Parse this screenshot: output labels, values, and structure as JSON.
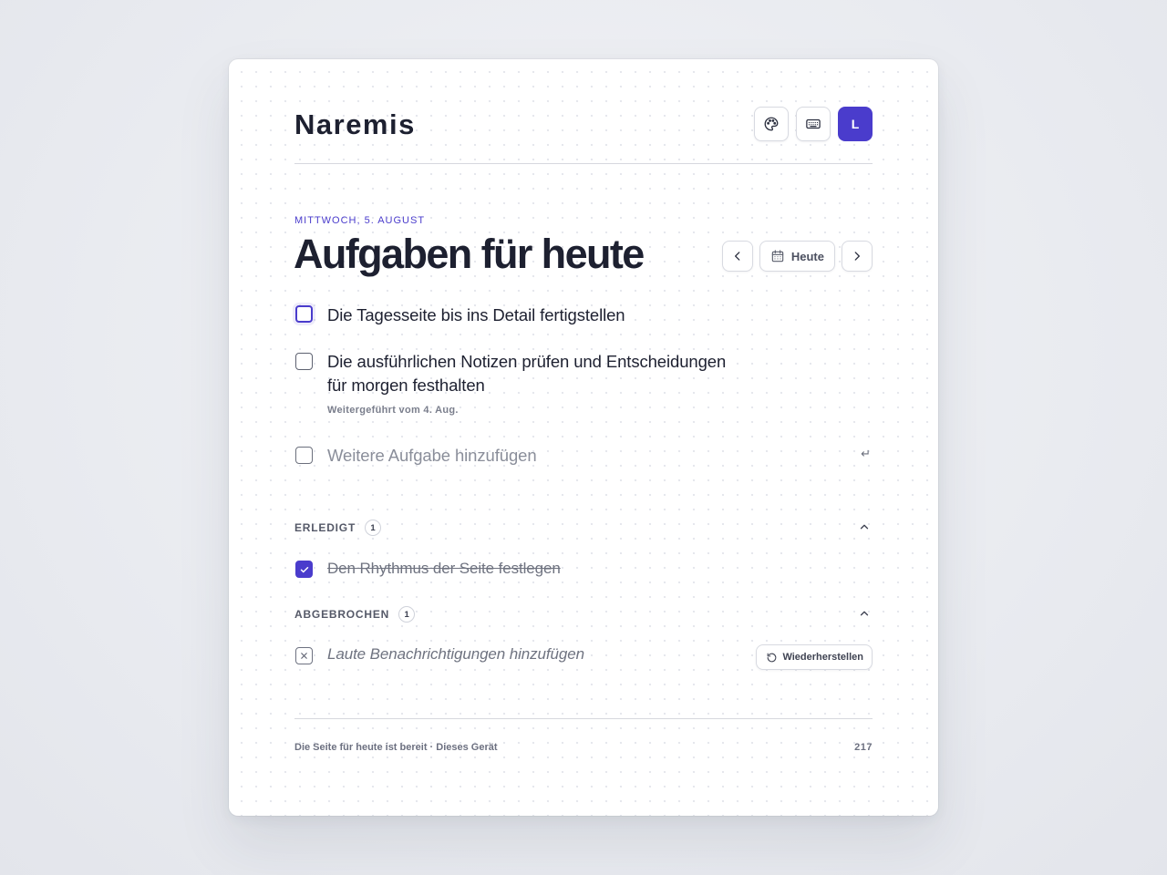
{
  "app": {
    "brand": "Naremis",
    "avatar_initial": "L",
    "accent_color": "#4a3ccc"
  },
  "header": {
    "actions": [
      {
        "icon": "palette-icon"
      },
      {
        "icon": "keyboard-icon"
      }
    ]
  },
  "page": {
    "date_label": "MITTWOCH, 5. AUGUST",
    "title": "Aufgaben für heute",
    "today_label": "Heute"
  },
  "tasks": [
    {
      "text": "Die Tagesseite bis ins Detail fertigstellen",
      "focused": true
    },
    {
      "text_line1": "Die ausführlichen Notizen prüfen und Entscheidungen",
      "text_line2": "für morgen festhalten",
      "meta": "Weitergeführt vom 4. Aug."
    }
  ],
  "new_task": {
    "placeholder": "Weitere Aufgabe hinzufügen",
    "enter_hint": "↵"
  },
  "sections": {
    "done": {
      "label": "ERLEDIGT",
      "count": "1",
      "items": [
        {
          "text": "Den Rhythmus der Seite festlegen"
        }
      ]
    },
    "cancelled": {
      "label": "ABGEBROCHEN",
      "count": "1",
      "items": [
        {
          "text": "Laute Benachrichtigungen hinzufügen",
          "restore_label": "Wiederherstellen"
        }
      ]
    }
  },
  "footer": {
    "status": "Die Seite für heute ist bereit · Dieses Gerät",
    "number": "217"
  }
}
